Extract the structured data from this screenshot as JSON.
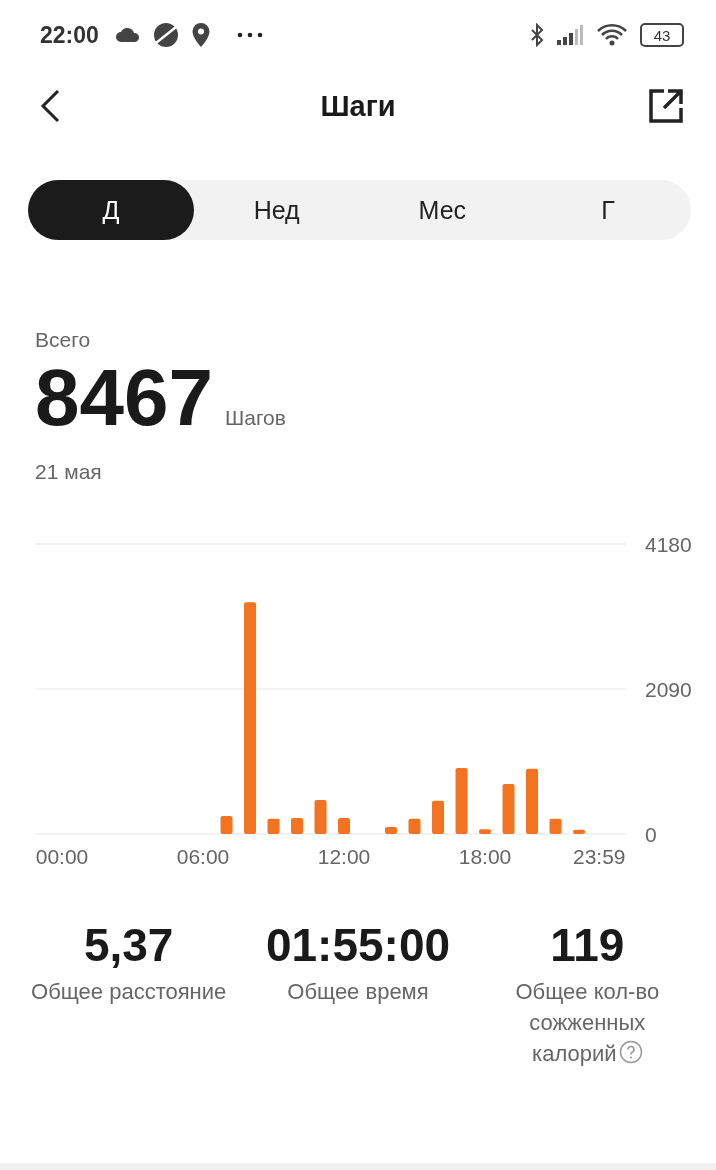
{
  "status_bar": {
    "time": "22:00",
    "battery": "43"
  },
  "header": {
    "title": "Шаги"
  },
  "tabs": [
    {
      "label": "Д",
      "selected": true
    },
    {
      "label": "Нед",
      "selected": false
    },
    {
      "label": "Мес",
      "selected": false
    },
    {
      "label": "Г",
      "selected": false
    }
  ],
  "summary": {
    "label": "Всего",
    "value": "8467",
    "unit": "Шагов",
    "date": "21 мая"
  },
  "chart_data": {
    "type": "bar",
    "x": [
      7,
      8,
      9,
      10,
      11,
      12,
      14,
      15,
      16,
      17,
      18,
      19,
      20,
      21,
      22
    ],
    "series": [
      {
        "color": "#f47320",
        "values": [
          260,
          3340,
          220,
          230,
          490,
          230,
          100,
          220,
          480,
          950,
          70,
          720,
          940,
          220,
          60
        ]
      }
    ],
    "xlim": [
      -1.15,
      24
    ],
    "ylim": [
      0,
      4180
    ],
    "yticks": [
      0,
      2090,
      4180
    ],
    "xticks": [
      {
        "value": 0,
        "label": "00:00"
      },
      {
        "value": 6,
        "label": "06:00"
      },
      {
        "value": 12,
        "label": "12:00"
      },
      {
        "value": 18,
        "label": "18:00"
      },
      {
        "value": 23.98,
        "label": "23:59"
      }
    ]
  },
  "stats": [
    {
      "value": "5,37",
      "label": "Общее расстояние",
      "help": false
    },
    {
      "value": "01:55:00",
      "label": "Общее время",
      "help": false
    },
    {
      "value": "119",
      "label": "Общее кол-во сожженных калорий",
      "help": true
    }
  ]
}
